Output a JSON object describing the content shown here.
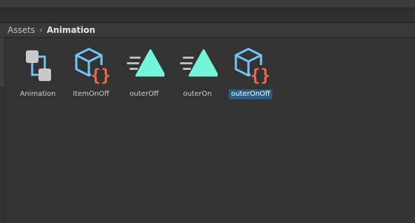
{
  "breadcrumb": {
    "root": "Assets",
    "separator": "›",
    "current": "Animation"
  },
  "assets": [
    {
      "label": "Animation",
      "icon": "folder-animation-graph-icon",
      "selected": false
    },
    {
      "label": "ItemOnOff",
      "icon": "animator-controller-icon",
      "selected": false
    },
    {
      "label": "outerOff",
      "icon": "animation-clip-icon",
      "selected": false
    },
    {
      "label": "outerOn",
      "icon": "animation-clip-icon",
      "selected": false
    },
    {
      "label": "outerOnOff",
      "icon": "animator-controller-icon",
      "selected": true
    }
  ],
  "colors": {
    "accent_blue": "#6fc3f7",
    "accent_orange": "#f06b43",
    "clip_teal": "#73f5d8",
    "selection": "#2c5d87"
  }
}
